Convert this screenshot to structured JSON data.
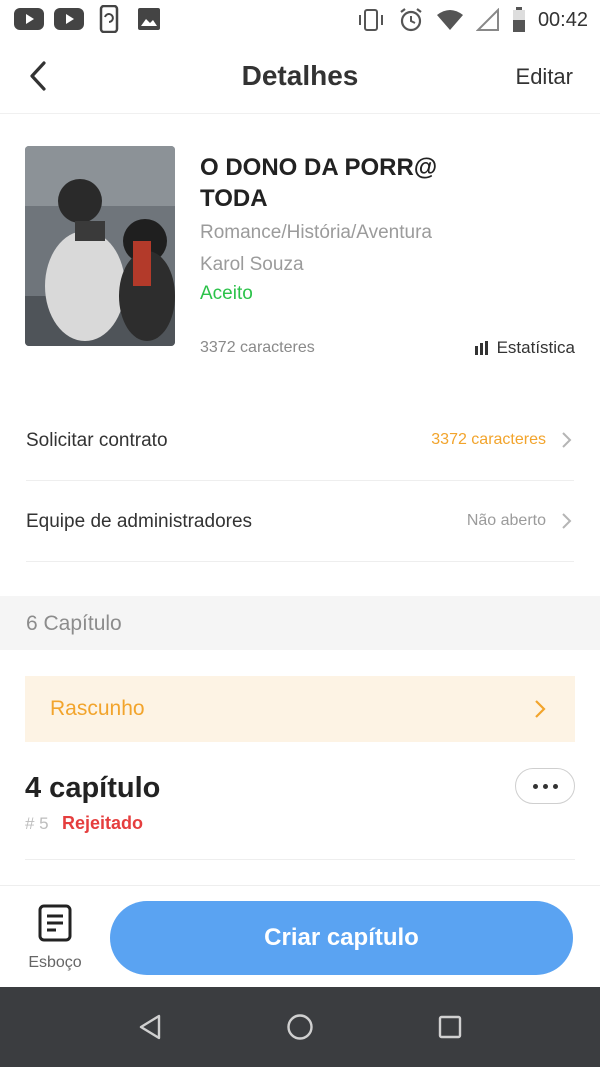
{
  "status_bar": {
    "time": "00:42",
    "left_icons": [
      "youtube-icon",
      "youtube-icon",
      "screen-rotation-icon",
      "image-icon"
    ],
    "right_icons": [
      "vibrate-icon",
      "alarm-icon",
      "wifi-icon",
      "signal-icon",
      "battery-icon"
    ]
  },
  "header": {
    "title": "Detalhes",
    "edit_label": "Editar",
    "back_icon": "chevron-left-icon"
  },
  "book": {
    "title": "O DONO DA PORR@ TODA",
    "genre": "Romance/História/Aventura",
    "author": "Karol Souza",
    "status": "Aceito",
    "status_color": "#2cc24a",
    "characters": "3372 caracteres",
    "stats_label": "Estatística",
    "stats_icon": "bar-chart-icon"
  },
  "rows": {
    "contract": {
      "label": "Solicitar contrato",
      "value": "3372 caracteres",
      "value_color": "#f2a42c"
    },
    "admins": {
      "label": "Equipe de administradores",
      "value": "Não aberto",
      "value_color": "#9b9b9b"
    }
  },
  "chapters": {
    "section_title": "6 Capítulo",
    "draft_label": "Rascunho",
    "items": [
      {
        "title": "4 capítulo",
        "number": "# 5",
        "status": "Rejeitado",
        "status_color": "#e53e3e"
      }
    ]
  },
  "bottom": {
    "draft_tab_label": "Esboço",
    "create_label": "Criar capítulo",
    "accent_color": "#5aa3f2"
  },
  "nav": {
    "icons": [
      "back-triangle-icon",
      "home-circle-icon",
      "recents-square-icon"
    ]
  }
}
